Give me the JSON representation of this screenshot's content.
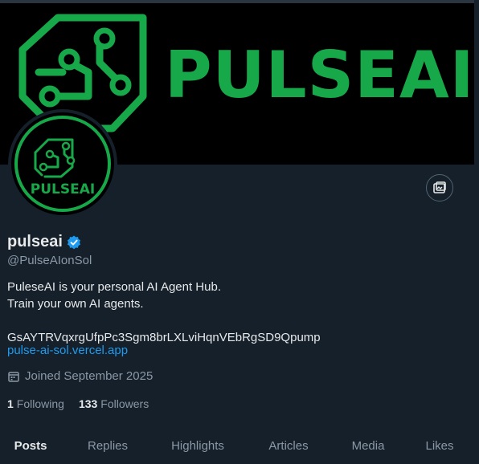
{
  "banner": {
    "brand_text": "PULSEAI"
  },
  "avatar": {
    "brand_text": "PULSEAI"
  },
  "profile": {
    "display_name": "pulseai",
    "handle": "@PulseAIonSol",
    "bio_lines": [
      "PuleseAI is your personal AI Agent Hub.",
      "Train your own AI agents.",
      "",
      "GsAYTRVqxrgUfpPc3Sgm8brLXLviHqnVEbRgSD9Qpump"
    ],
    "website": "pulse-ai-sol.vercel.app",
    "joined": "Joined September 2025",
    "following_count": "1",
    "following_label": "Following",
    "followers_count": "133",
    "followers_label": "Followers"
  },
  "tabs": [
    {
      "label": "Posts",
      "active": true
    },
    {
      "label": "Replies",
      "active": false
    },
    {
      "label": "Highlights",
      "active": false
    },
    {
      "label": "Articles",
      "active": false
    },
    {
      "label": "Media",
      "active": false
    },
    {
      "label": "Likes",
      "active": false
    }
  ],
  "colors": {
    "background": "#15202b",
    "brand_green": "#17a84a",
    "link": "#1d9bf0",
    "verified": "#1d9bf0"
  },
  "icons": {
    "edit_photo": "image-edit-icon",
    "verified": "verified-badge-icon",
    "calendar": "calendar-icon"
  }
}
